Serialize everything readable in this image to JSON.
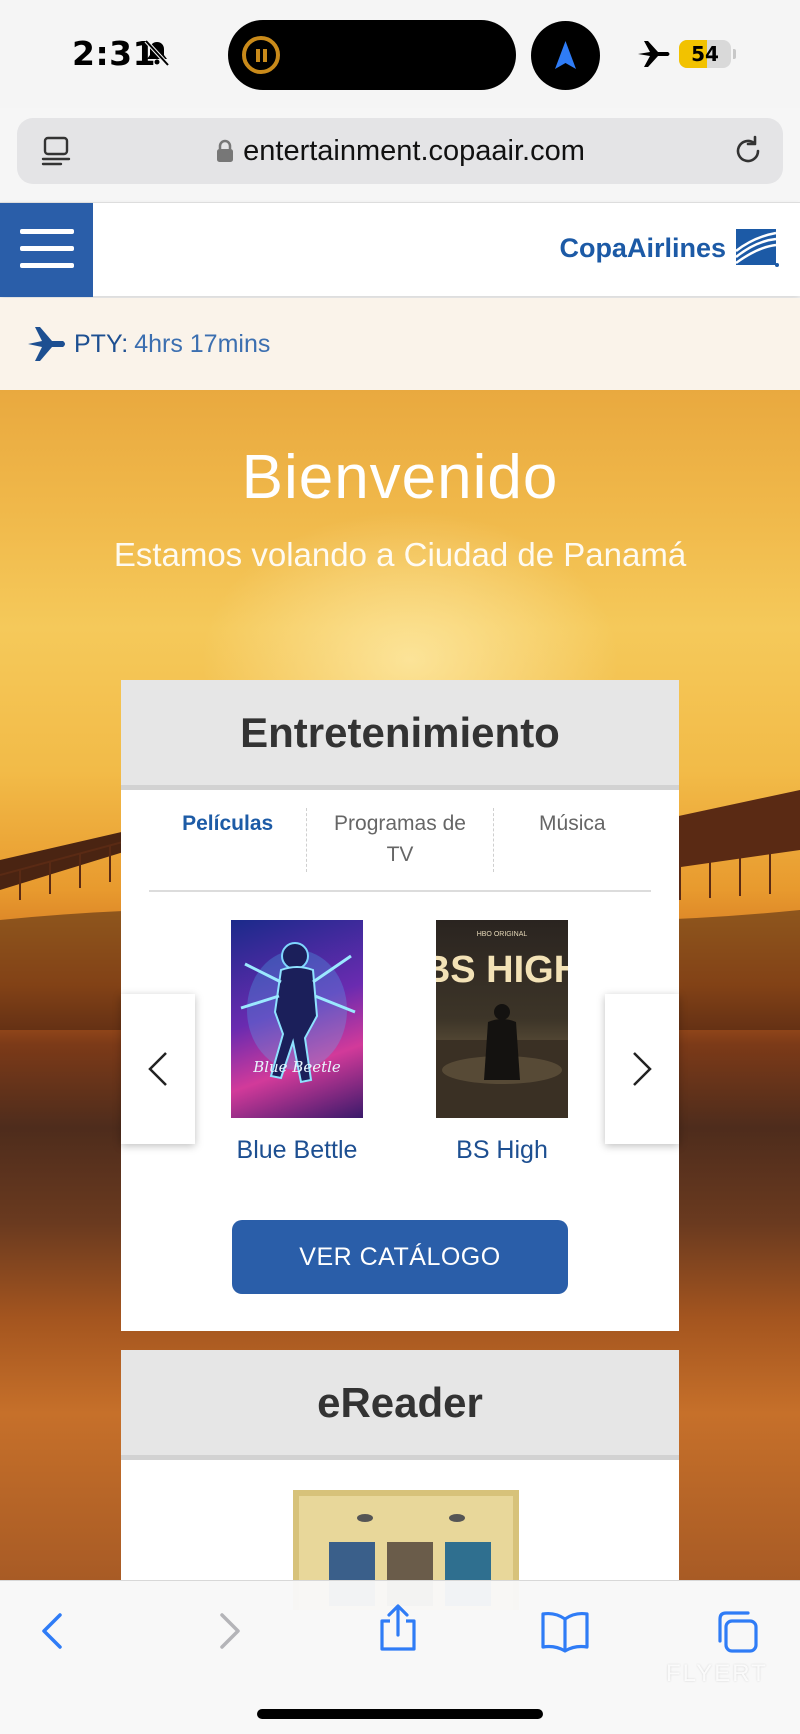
{
  "status_bar": {
    "time": "2:31",
    "battery": "54",
    "battery_level": 0.54
  },
  "browser": {
    "url": "entertainment.copaair.com"
  },
  "site": {
    "brand": "CopaAirlines"
  },
  "flight": {
    "code": "PTY:",
    "remaining": "4hrs 17mins"
  },
  "hero": {
    "title": "Bienvenido",
    "subtitle": "Estamos volando a Ciudad de Panamá"
  },
  "entertainment": {
    "title": "Entretenimiento",
    "tabs": [
      "Películas",
      "Programas de TV",
      "Música"
    ],
    "movies": [
      {
        "title": "Blue Bettle",
        "poster_text": "Blue Beetle"
      },
      {
        "title": "BS High",
        "poster_text": "BS HIGH",
        "poster_badge": "HBO ORIGINAL"
      }
    ],
    "cta": "VER CATÁLOGO"
  },
  "ereader": {
    "title": "eReader"
  },
  "watermark": "FLYERT",
  "colors": {
    "brand_blue": "#2a5ea9",
    "link_blue": "#1d5ba6",
    "ios_blue": "#2f7cf6"
  },
  "icons": {
    "menu": "hamburger-icon",
    "flight": "airplane-icon",
    "back": "chevron-left-icon",
    "forward": "chevron-right-icon",
    "share": "share-icon",
    "bookmarks": "book-icon",
    "tabs": "tabs-icon"
  }
}
